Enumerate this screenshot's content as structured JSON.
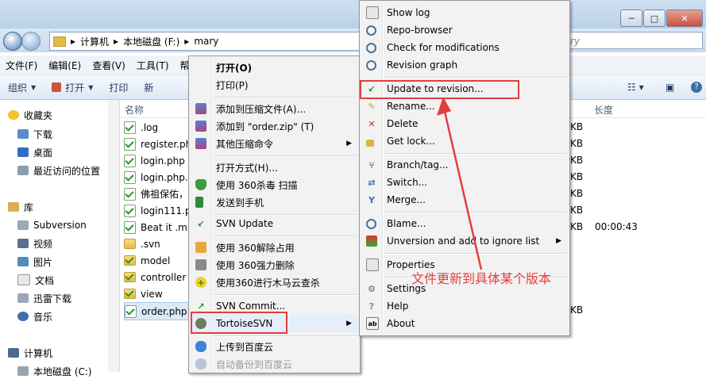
{
  "window": {
    "minimize": "─",
    "maximize": "□",
    "close": "✕"
  },
  "address": {
    "crumbs": [
      "计算机",
      "本地磁盘 (F:)",
      "mary"
    ],
    "sep": "▸",
    "search_placeholder": "mary"
  },
  "menubar": [
    "文件(F)",
    "编辑(E)",
    "查看(V)",
    "工具(T)",
    "帮"
  ],
  "commandbar": {
    "organize": "组织",
    "open": "打开",
    "print": "打印",
    "new": "新"
  },
  "nav": {
    "favorites": "收藏夹",
    "fav_items": [
      "下载",
      "桌面",
      "最近访问的位置"
    ],
    "library": "库",
    "lib_items": [
      "Subversion",
      "视频",
      "图片",
      "文档",
      "迅雷下载",
      "音乐"
    ],
    "computer": "计算机",
    "computer_items": [
      "本地磁盘 (C:)"
    ]
  },
  "filelist": {
    "columns": {
      "name": "名称",
      "length": "长度"
    },
    "rows": [
      {
        "name": ".log",
        "size": "KB",
        "length": ""
      },
      {
        "name": "register.ph",
        "size": "KB",
        "length": ""
      },
      {
        "name": "login.php",
        "size": "KB",
        "length": ""
      },
      {
        "name": "login.php.",
        "size": "KB",
        "length": ""
      },
      {
        "name": "佛祖保佑，",
        "size": "KB",
        "length": ""
      },
      {
        "name": "login111.p",
        "size": "KB",
        "length": ""
      },
      {
        "name": "Beat it .mp",
        "size": "KB",
        "length": "00:00:43"
      },
      {
        "name": ".svn",
        "size": "",
        "length": ""
      },
      {
        "name": "model",
        "size": "",
        "length": ""
      },
      {
        "name": "controller",
        "size": "",
        "length": ""
      },
      {
        "name": "view",
        "size": "",
        "length": ""
      },
      {
        "name": "order.php",
        "size": "KB",
        "length": ""
      }
    ]
  },
  "context_menu": {
    "items": [
      {
        "label": "打开(O)"
      },
      {
        "label": "打印(P)"
      },
      {
        "label": "添加到压缩文件(A)..."
      },
      {
        "label": "添加到 \"order.zip\" (T)"
      },
      {
        "label": "其他压缩命令"
      },
      {
        "label": "打开方式(H)..."
      },
      {
        "label": "使用 360杀毒 扫描"
      },
      {
        "label": "发送到手机"
      },
      {
        "label": "SVN Update"
      },
      {
        "label": "使用 360解除占用"
      },
      {
        "label": "使用 360强力删除"
      },
      {
        "label": "使用360进行木马云查杀"
      },
      {
        "label": "SVN Commit..."
      },
      {
        "label": "TortoiseSVN"
      },
      {
        "label": "上传到百度云"
      },
      {
        "label": "自动备份到百度云"
      }
    ]
  },
  "tortoise_menu": {
    "items": [
      {
        "label": "Show log"
      },
      {
        "label": "Repo-browser"
      },
      {
        "label": "Check for modifications"
      },
      {
        "label": "Revision graph"
      },
      {
        "label": "Update to revision..."
      },
      {
        "label": "Rename..."
      },
      {
        "label": "Delete"
      },
      {
        "label": "Get lock..."
      },
      {
        "label": "Branch/tag..."
      },
      {
        "label": "Switch..."
      },
      {
        "label": "Merge..."
      },
      {
        "label": "Blame..."
      },
      {
        "label": "Unversion and add to ignore list"
      },
      {
        "label": "Properties"
      },
      {
        "label": "Settings"
      },
      {
        "label": "Help"
      },
      {
        "label": "About"
      }
    ]
  },
  "annotation": "文件更新到具体某个版本",
  "colors": {
    "highlight": "#e53d3d",
    "accent": "#3d6fa6"
  }
}
